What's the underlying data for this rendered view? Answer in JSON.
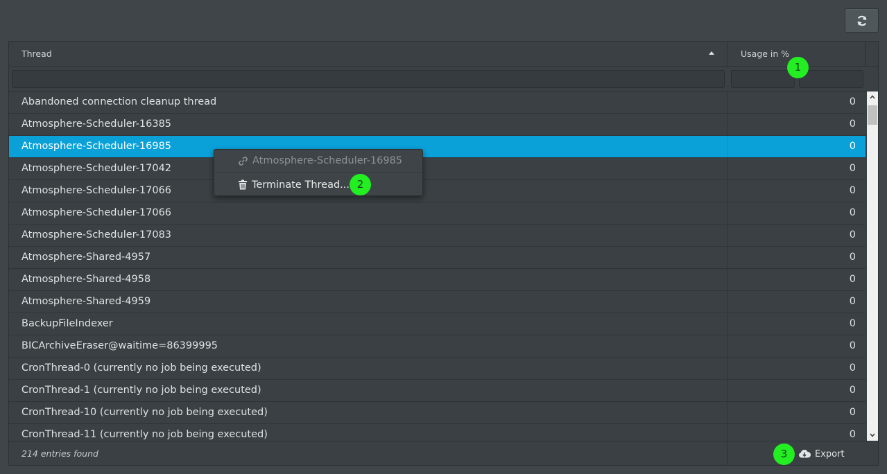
{
  "toolbar": {
    "refresh_icon": "refresh-icon"
  },
  "table": {
    "columns": [
      {
        "label": "Thread",
        "sort": "ascending"
      },
      {
        "label": "Usage in %"
      }
    ],
    "filters": {
      "thread": "",
      "usage_min": "",
      "usage_max": ""
    },
    "rows": [
      {
        "thread": "Abandoned connection cleanup thread",
        "usage": "0"
      },
      {
        "thread": "Atmosphere-Scheduler-16385",
        "usage": "0"
      },
      {
        "thread": "Atmosphere-Scheduler-16985",
        "usage": "0",
        "selected": true
      },
      {
        "thread": "Atmosphere-Scheduler-17042",
        "usage": "0"
      },
      {
        "thread": "Atmosphere-Scheduler-17066",
        "usage": "0"
      },
      {
        "thread": "Atmosphere-Scheduler-17066",
        "usage": "0"
      },
      {
        "thread": "Atmosphere-Scheduler-17083",
        "usage": "0"
      },
      {
        "thread": "Atmosphere-Shared-4957",
        "usage": "0"
      },
      {
        "thread": "Atmosphere-Shared-4958",
        "usage": "0"
      },
      {
        "thread": "Atmosphere-Shared-4959",
        "usage": "0"
      },
      {
        "thread": "BackupFileIndexer",
        "usage": "0"
      },
      {
        "thread": "BICArchiveEraser@waitime=86399995",
        "usage": "0"
      },
      {
        "thread": "CronThread-0 (currently no job being executed)",
        "usage": "0"
      },
      {
        "thread": "CronThread-1 (currently no job being executed)",
        "usage": "0"
      },
      {
        "thread": "CronThread-10 (currently no job being executed)",
        "usage": "0"
      },
      {
        "thread": "CronThread-11 (currently no job being executed)",
        "usage": "0"
      }
    ],
    "footer": {
      "count_text": "214 entries found",
      "export_label": "Export"
    }
  },
  "context_menu": {
    "title": "Atmosphere-Scheduler-16985",
    "title_icon": "link-icon",
    "action_label": "Terminate Thread...",
    "action_icon": "trash-icon"
  },
  "annotations": [
    "1",
    "2",
    "3"
  ],
  "colors": {
    "background": "#3f4548",
    "selected_row": "#0aa0d8",
    "badge": "#22ee22"
  }
}
